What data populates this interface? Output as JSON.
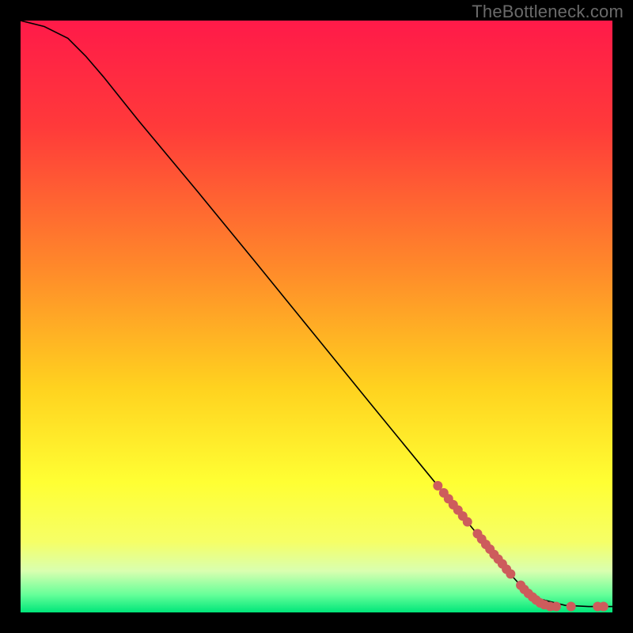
{
  "watermark": "TheBottleneck.com",
  "colors": {
    "frame": "#000000",
    "watermark": "#6a6a6a",
    "curve": "#000000",
    "marker": "#cd5c5c",
    "gradient_stops": [
      {
        "offset": 0.0,
        "color": "#ff1a49"
      },
      {
        "offset": 0.18,
        "color": "#ff3a3a"
      },
      {
        "offset": 0.42,
        "color": "#ff8a2a"
      },
      {
        "offset": 0.62,
        "color": "#ffd21f"
      },
      {
        "offset": 0.78,
        "color": "#ffff33"
      },
      {
        "offset": 0.88,
        "color": "#f6ff66"
      },
      {
        "offset": 0.93,
        "color": "#d9ffb0"
      },
      {
        "offset": 0.97,
        "color": "#66ff99"
      },
      {
        "offset": 1.0,
        "color": "#00e67a"
      }
    ]
  },
  "chart_data": {
    "type": "line",
    "title": "",
    "xlabel": "",
    "ylabel": "",
    "xlim": [
      0,
      100
    ],
    "ylim": [
      0,
      100
    ],
    "grid": false,
    "series": [
      {
        "name": "curve",
        "x": [
          0,
          4,
          8,
          11,
          14,
          20,
          30,
          40,
          50,
          60,
          70,
          78,
          83,
          85,
          88,
          92,
          96,
          100
        ],
        "y": [
          100,
          99,
          97,
          94,
          90.5,
          83,
          71,
          58.8,
          46.5,
          34.2,
          22,
          12.2,
          6.2,
          4.0,
          2.2,
          1.2,
          1.0,
          1.0
        ]
      }
    ],
    "markers": {
      "name": "highlight-points",
      "points": [
        {
          "x": 70.5,
          "y": 21.4
        },
        {
          "x": 71.5,
          "y": 20.2
        },
        {
          "x": 72.3,
          "y": 19.2
        },
        {
          "x": 73.1,
          "y": 18.2
        },
        {
          "x": 73.9,
          "y": 17.3
        },
        {
          "x": 74.7,
          "y": 16.3
        },
        {
          "x": 75.5,
          "y": 15.3
        },
        {
          "x": 77.2,
          "y": 13.3
        },
        {
          "x": 77.9,
          "y": 12.4
        },
        {
          "x": 78.6,
          "y": 11.5
        },
        {
          "x": 79.3,
          "y": 10.7
        },
        {
          "x": 80.0,
          "y": 9.8
        },
        {
          "x": 80.7,
          "y": 9.0
        },
        {
          "x": 81.4,
          "y": 8.2
        },
        {
          "x": 82.1,
          "y": 7.3
        },
        {
          "x": 82.8,
          "y": 6.5
        },
        {
          "x": 84.5,
          "y": 4.6
        },
        {
          "x": 85.1,
          "y": 3.9
        },
        {
          "x": 85.8,
          "y": 3.2
        },
        {
          "x": 86.5,
          "y": 2.6
        },
        {
          "x": 87.1,
          "y": 2.1
        },
        {
          "x": 87.8,
          "y": 1.6
        },
        {
          "x": 88.5,
          "y": 1.3
        },
        {
          "x": 89.5,
          "y": 1.0
        },
        {
          "x": 90.5,
          "y": 1.0
        },
        {
          "x": 93.0,
          "y": 1.0
        },
        {
          "x": 97.5,
          "y": 1.0
        },
        {
          "x": 98.5,
          "y": 1.0
        }
      ]
    }
  }
}
